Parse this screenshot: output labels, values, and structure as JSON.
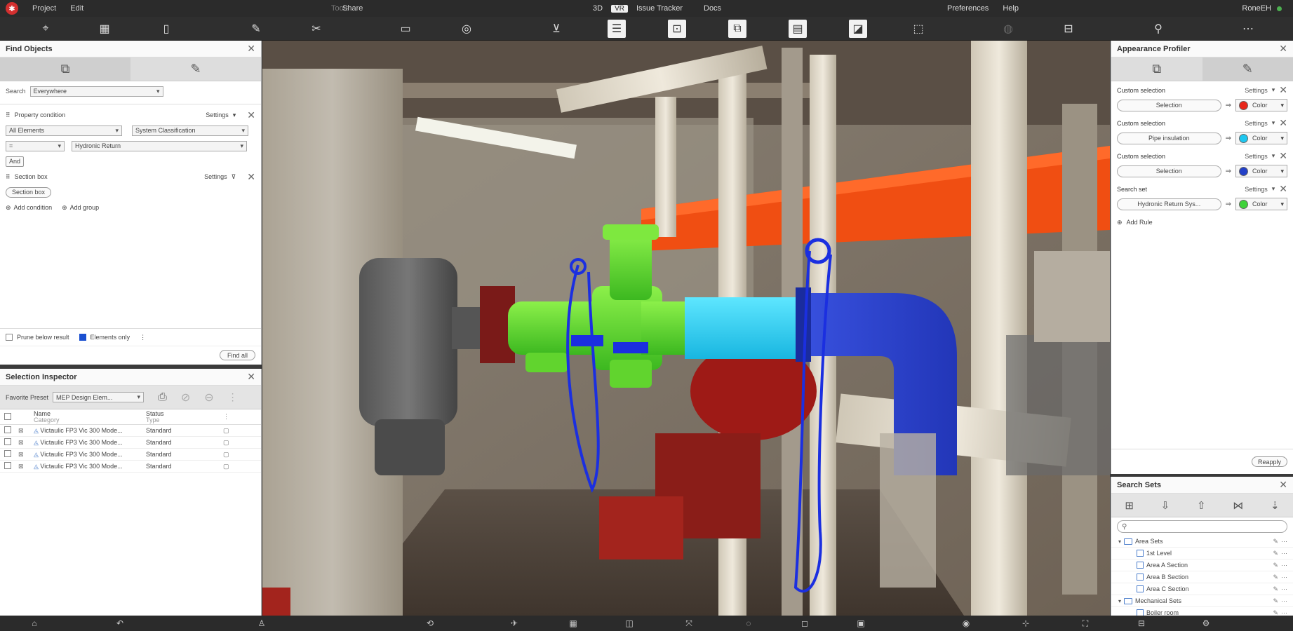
{
  "menubar": {
    "items": [
      "Project",
      "Edit"
    ],
    "center_items": [
      "Tools",
      "Share"
    ],
    "mode_3d": "3D",
    "mode_selected": "VR",
    "issue_tracker": "Issue Tracker",
    "docs": "Docs",
    "right_items": [
      "Preferences",
      "Help"
    ],
    "user": "RoneEH"
  },
  "find_objects": {
    "title": "Find Objects",
    "search_label": "Search",
    "search_scope": "Everywhere",
    "condition_label": "Property condition",
    "settings_label": "Settings",
    "field_a": "All Elements",
    "field_b": "System Classification",
    "operator": "=",
    "value": "Hydronic Return",
    "and_button": "And",
    "section_label": "Section box",
    "section_button": "Section box",
    "add_condition": "Add condition",
    "add_group": "Add group",
    "prune_label": "Prune below result",
    "elements_only_label": "Elements only",
    "find_button": "Find all"
  },
  "selection_inspector": {
    "title": "Selection Inspector",
    "favorite_label": "Favorite Preset",
    "preset_value": "MEP Design Elem...",
    "col_name": "Name",
    "col_name_sub": "Category",
    "col_type": "Status",
    "col_type_sub": "Type",
    "rows": [
      {
        "name": "Victaulic FP3 Vic 300 Mode...",
        "type": "Standard"
      },
      {
        "name": "Victaulic FP3 Vic 300 Mode...",
        "type": "Standard"
      },
      {
        "name": "Victaulic FP3 Vic 300 Mode...",
        "type": "Standard"
      },
      {
        "name": "Victaulic FP3 Vic 300 Mode...",
        "type": "Standard"
      }
    ]
  },
  "appearance_profiler": {
    "title": "Appearance Profiler",
    "rules": [
      {
        "label": "Custom selection",
        "pill": "Selection",
        "color_label": "Color",
        "color": "#e8261a"
      },
      {
        "label": "Custom selection",
        "pill": "Pipe insulation",
        "color_label": "Color",
        "color": "#1ec7f0"
      },
      {
        "label": "Custom selection",
        "pill": "Selection",
        "color_label": "Color",
        "color": "#2340c8"
      },
      {
        "label": "Search set",
        "pill": "Hydronic Return Sys...",
        "color_label": "Color",
        "color": "#3fd23a"
      }
    ],
    "settings_label": "Settings",
    "add_rule": "Add Rule",
    "reapply": "Reapply"
  },
  "search_sets": {
    "title": "Search Sets",
    "tree": [
      {
        "label": "Area Sets",
        "level": 0,
        "kind": "folder"
      },
      {
        "label": "1st Level",
        "level": 1,
        "kind": "set"
      },
      {
        "label": "Area A Section",
        "level": 1,
        "kind": "set"
      },
      {
        "label": "Area B Section",
        "level": 1,
        "kind": "set"
      },
      {
        "label": "Area C Section",
        "level": 1,
        "kind": "set"
      },
      {
        "label": "Mechanical Sets",
        "level": 0,
        "kind": "folder"
      },
      {
        "label": "Boiler room",
        "level": 1,
        "kind": "set"
      }
    ]
  },
  "icons": {
    "toolbar": [
      "location-icon",
      "map-icon",
      "phone-icon",
      "ruler-icon",
      "scissors-icon",
      "screen-icon",
      "settings-circle-icon",
      "basket-icon",
      "panel-icon",
      "drawing-icon",
      "layers-icon",
      "doc-icon",
      "paint-icon",
      "cube-icon",
      "lock-icon",
      "box-icon",
      "link-icon",
      "more-icon"
    ]
  }
}
